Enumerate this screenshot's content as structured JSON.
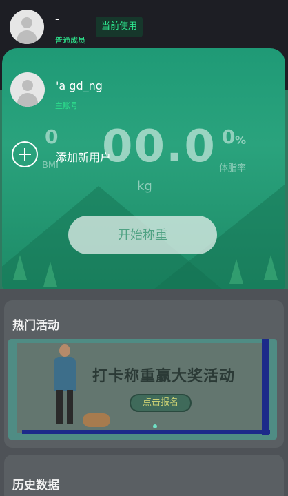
{
  "current_user": {
    "name": "-",
    "role": "普通成员",
    "badge": "当前使用"
  },
  "dropdown": {
    "main_account": {
      "name": "'a gd_ng",
      "role": "主账号"
    },
    "add_user_label": "添加新用户"
  },
  "scale": {
    "bmi_value": "0",
    "bmi_label": "BMI",
    "weight_value": "00.0",
    "weight_unit": "kg",
    "fat_value": "0",
    "fat_unit": "%",
    "fat_label": "体脂率",
    "start_button": "开始称重"
  },
  "sections": {
    "hot_activities_title": "热门活动",
    "history_title": "历史数据"
  },
  "banner": {
    "title": "打卡称重赢大奖活动",
    "signup_button": "点击报名"
  },
  "icons": {
    "avatar": "avatar-icon",
    "add": "plus-circle-icon"
  },
  "colors": {
    "accent": "#2ee88f",
    "panel_green": "#2aa37d",
    "topbar": "#1d1e24"
  }
}
